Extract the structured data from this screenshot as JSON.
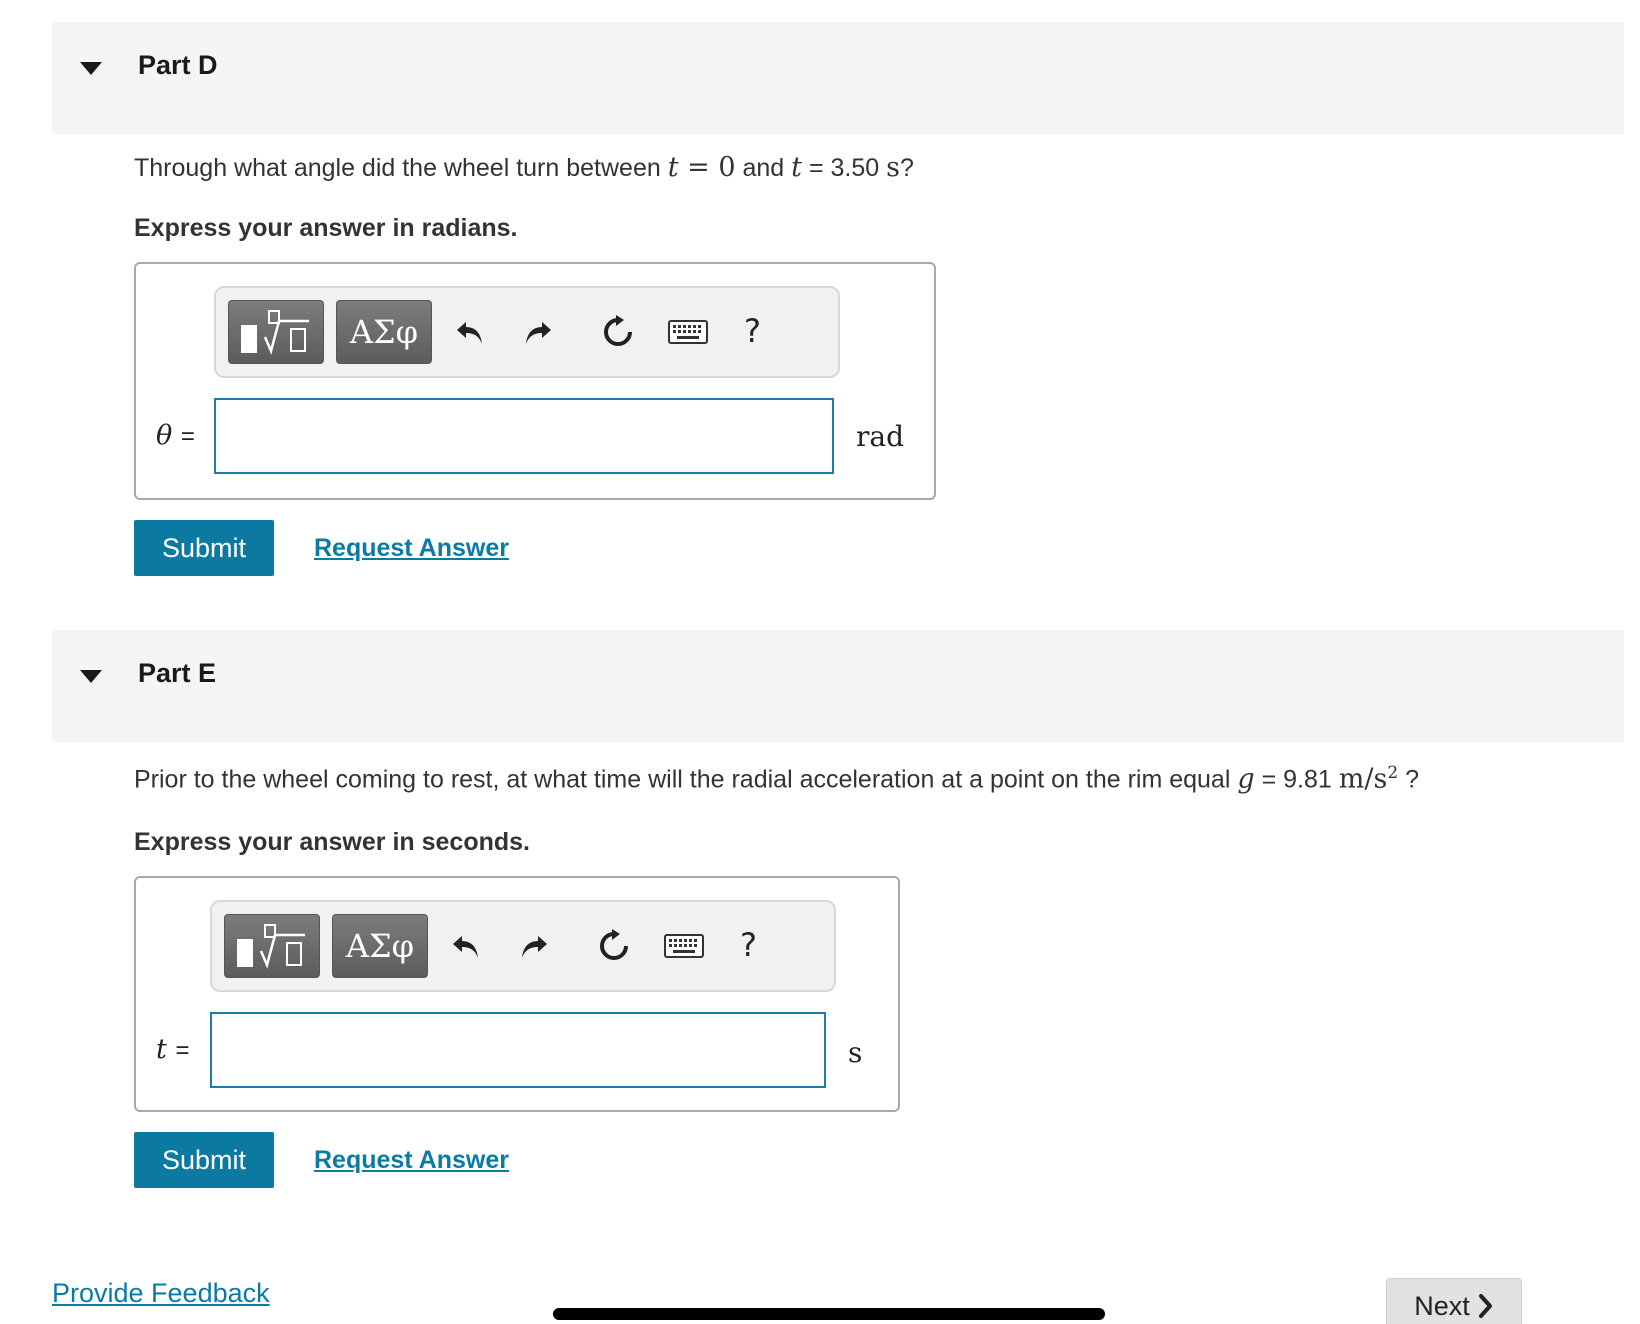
{
  "partD": {
    "title": "Part D",
    "question": {
      "pre": "Through what angle did the wheel turn between ",
      "t1": "t",
      "eq1": " = 0",
      "and": " and ",
      "t2": "t",
      "eq2": " = 3.50 ",
      "unit": "s",
      "end": "?"
    },
    "instruction": "Express your answer in radians.",
    "toolbar": {
      "greek": "ΑΣφ",
      "help": "?"
    },
    "variable": "θ",
    "equals": "=",
    "input_value": "",
    "unit": "rad",
    "submit": "Submit",
    "request": "Request Answer"
  },
  "partE": {
    "title": "Part E",
    "question": {
      "pre": "Prior to the wheel coming to rest, at what time will the radial acceleration at a point on the rim equal ",
      "g": "g",
      "eq": " = 9.81 ",
      "unit": "m/s",
      "exp": "2",
      "end": " ?"
    },
    "instruction": "Express your answer in seconds.",
    "toolbar": {
      "greek": "ΑΣφ",
      "help": "?"
    },
    "variable": "t",
    "equals": "=",
    "input_value": "",
    "unit": "s",
    "submit": "Submit",
    "request": "Request Answer"
  },
  "footer": {
    "feedback": "Provide Feedback",
    "next": "Next"
  },
  "colors": {
    "accent": "#0c7aa0",
    "link": "#0b7ba6",
    "header_bg": "#f5f5f5"
  }
}
